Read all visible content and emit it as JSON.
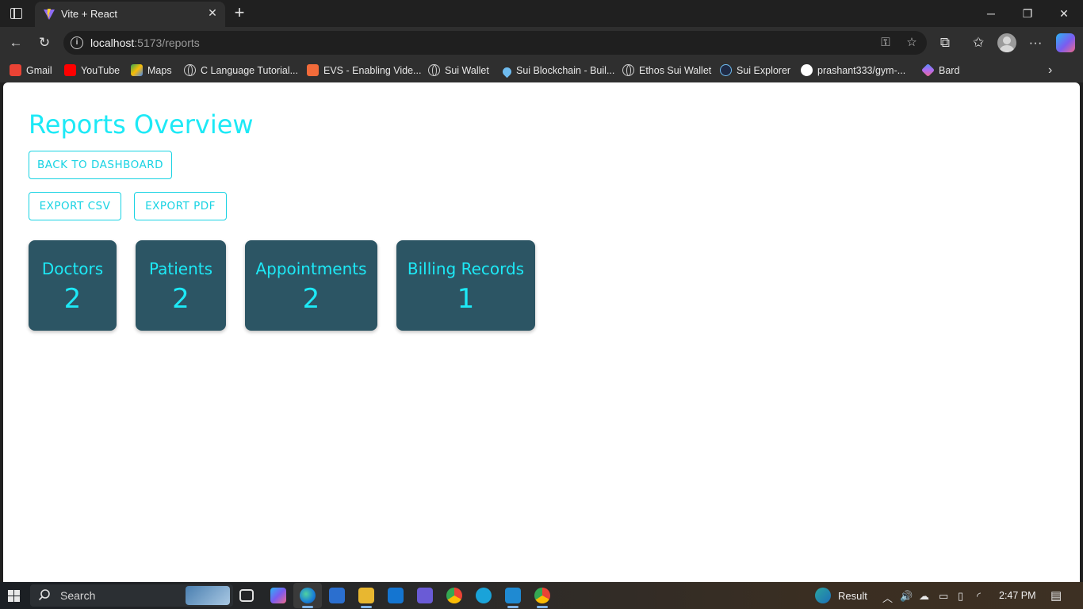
{
  "browser": {
    "tab_title": "Vite + React",
    "url_host": "localhost",
    "url_path": ":5173/reports",
    "bookmarks": [
      {
        "label": "Gmail",
        "icon": "gmail-icon",
        "color": "#ea4335"
      },
      {
        "label": "YouTube",
        "icon": "youtube-icon",
        "color": "#ff0000"
      },
      {
        "label": "Maps",
        "icon": "maps-icon",
        "color": "#34a853"
      },
      {
        "label": "C Language Tutorial...",
        "icon": "globe-icon",
        "color": "#cfcfcf"
      },
      {
        "label": "EVS - Enabling Vide...",
        "icon": "evs-icon",
        "color": "#f26b3a"
      },
      {
        "label": "Sui Wallet",
        "icon": "globe-icon",
        "color": "#cfcfcf"
      },
      {
        "label": "Sui Blockchain - Buil...",
        "icon": "sui-drop-icon",
        "color": "#6fbcf0"
      },
      {
        "label": "Ethos Sui Wallet",
        "icon": "globe-icon",
        "color": "#cfcfcf"
      },
      {
        "label": "Sui Explorer",
        "icon": "sui-explorer-icon",
        "color": "#1f2a44"
      },
      {
        "label": "prashant333/gym-...",
        "icon": "github-icon",
        "color": "#ffffff"
      },
      {
        "label": "Bard",
        "icon": "bard-icon",
        "color": "#8e7cf0"
      }
    ]
  },
  "page": {
    "title": "Reports Overview",
    "back_button": "BACK TO DASHBOARD",
    "export_csv": "EXPORT CSV",
    "export_pdf": "EXPORT PDF",
    "cards": [
      {
        "label": "Doctors",
        "value": "2"
      },
      {
        "label": "Patients",
        "value": "2"
      },
      {
        "label": "Appointments",
        "value": "2"
      },
      {
        "label": "Billing Records",
        "value": "1"
      }
    ],
    "accent_color": "#1de9f6",
    "card_color": "#2c5564"
  },
  "taskbar": {
    "search_placeholder": "Search",
    "weather_label": "Result",
    "time": "2:47 PM"
  }
}
